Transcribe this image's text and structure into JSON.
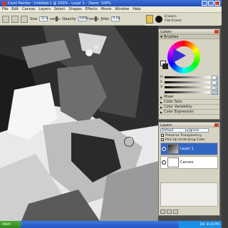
{
  "window": {
    "title": "Corel Painter - Untitled-1 @ 100% - Layer 1 - Zoom: 100%"
  },
  "menu": [
    "File",
    "Edit",
    "Canvas",
    "Layers",
    "Select",
    "Shapes",
    "Effects",
    "Movie",
    "Window",
    "Help"
  ],
  "property_bar": {
    "size_label": "Size",
    "size_value": "32.9",
    "opacity_label": "Opacity",
    "opacity_value": "100%",
    "jitter_label": "Jitter",
    "jitter_value": "0.00"
  },
  "brush_selector": {
    "category": "Erasers",
    "variant": "Flat Eraser"
  },
  "colors_palette": {
    "title": "Colors",
    "mixer_title": "Brushes",
    "sliders": [
      {
        "label": "H",
        "value": "0"
      },
      {
        "label": "S",
        "value": "0"
      },
      {
        "label": "V",
        "value": "75"
      },
      {
        "label": "",
        "value": "255"
      }
    ],
    "collapsed": [
      "Mixer",
      "Color Sets",
      "Color Variability",
      "Color Expression"
    ],
    "accent": "#3b2ad6"
  },
  "layers_palette": {
    "title": "Layers",
    "composite_method": "Default",
    "composite_depth": "Ignore",
    "preserve_transparency": "Preserve Transparency",
    "pick_up_underlying": "Pick Up Underlying Color",
    "layers": [
      {
        "name": "Layer 1",
        "active": true
      },
      {
        "name": "Canvas",
        "active": false
      }
    ],
    "active_color": "#3166c4"
  },
  "taskbar": {
    "start_label": "start",
    "lang": "EN",
    "clock": "8:20 PM"
  }
}
